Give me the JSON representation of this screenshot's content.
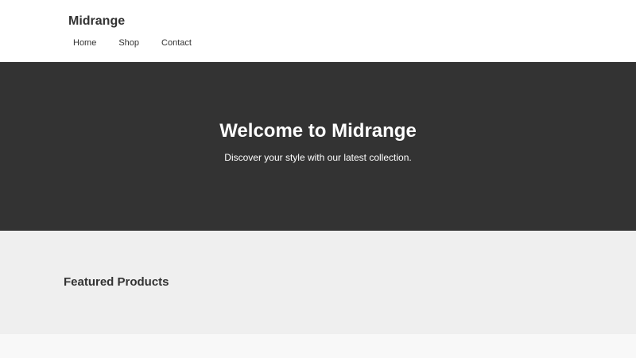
{
  "header": {
    "brand": "Midrange",
    "nav": {
      "home": "Home",
      "shop": "Shop",
      "contact": "Contact"
    }
  },
  "hero": {
    "title": "Welcome to Midrange",
    "subtitle": "Discover your style with our latest collection."
  },
  "featured": {
    "title": "Featured Products"
  },
  "colors": {
    "hero_bg": "#333333",
    "featured_bg": "#efefef",
    "page_bg": "#f8f8f8",
    "header_bg": "#ffffff"
  }
}
